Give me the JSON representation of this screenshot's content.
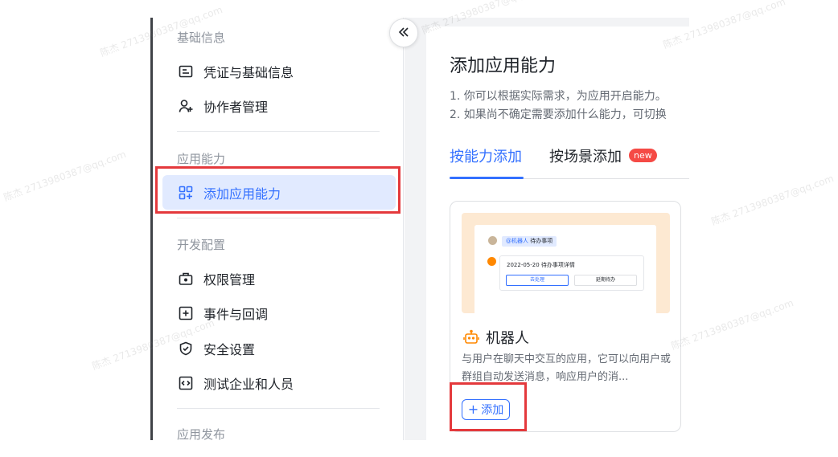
{
  "sidebar": {
    "sections": {
      "basic": "基础信息",
      "capability": "应用能力",
      "dev": "开发配置",
      "publish": "应用发布"
    },
    "items": {
      "credentials": "凭证与基础信息",
      "collaborators": "协作者管理",
      "add_capability": "添加应用能力",
      "permissions": "权限管理",
      "events": "事件与回调",
      "security": "安全设置",
      "test_enterprise": "测试企业和人员"
    }
  },
  "main": {
    "title": "添加应用能力",
    "desc_1": "1. 你可以根据实际需求，为应用开启能力。",
    "desc_2": "2. 如果尚不确定需要添加什么能力，可切换",
    "tabs": {
      "by_capability": "按能力添加",
      "by_scenario": "按场景添加",
      "new_badge": "new"
    },
    "card": {
      "preview": {
        "chip_tag": "@机器人",
        "chip_text": "待办事项",
        "message": "2022-05-20 待办事项详情",
        "button_1": "去处理",
        "button_2": "延期待办"
      },
      "title": "机器人",
      "description": "与用户在聊天中交互的应用，它可以向用户或群组自动发送消息，响应用户的消...",
      "add_button": "添加"
    }
  },
  "watermark": "陈杰 2713980387@qq.com",
  "colors": {
    "accent": "#3370ff",
    "active_bg": "#e1eaff",
    "highlight": "#e4393c",
    "badge": "#f54a45",
    "preview_bg": "#fde9d2"
  }
}
